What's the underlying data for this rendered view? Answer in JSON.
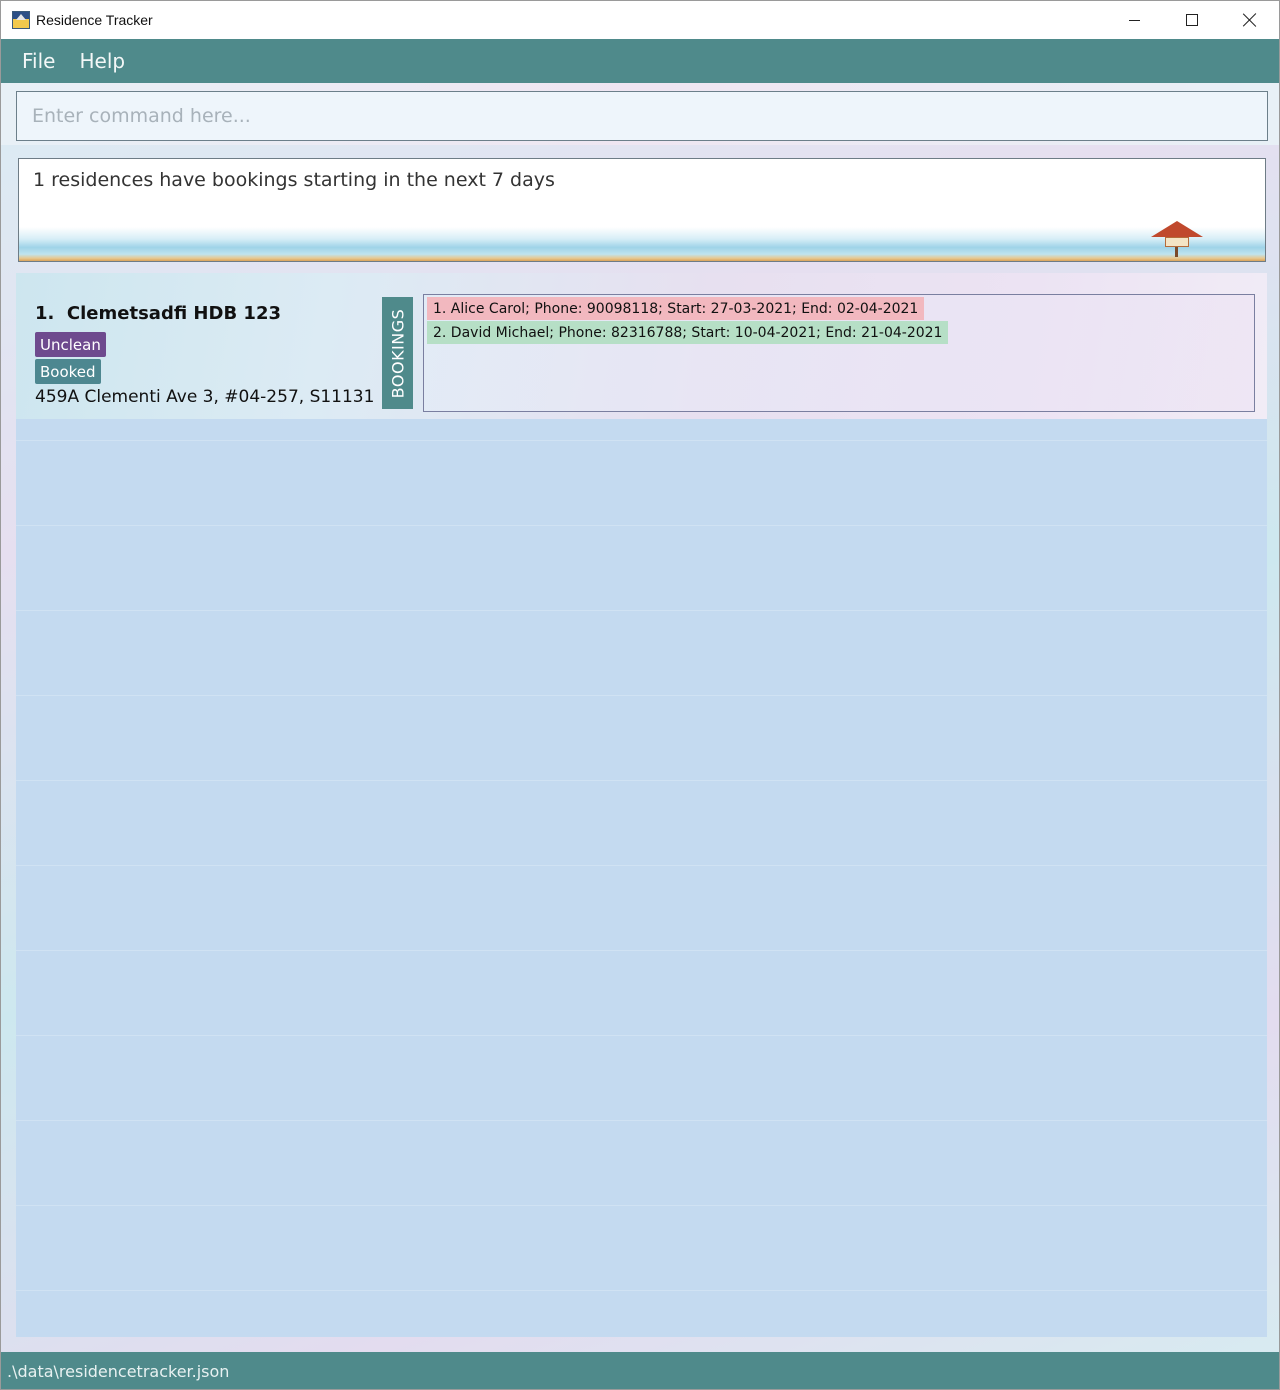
{
  "window": {
    "title": "Residence Tracker",
    "icon": "app-house-icon",
    "controls": [
      "minimize-icon",
      "maximize-icon",
      "close-icon"
    ]
  },
  "menu": {
    "items": [
      {
        "label": "File"
      },
      {
        "label": "Help"
      }
    ]
  },
  "command": {
    "placeholder": "Enter command here...",
    "value": ""
  },
  "result": {
    "message": "1 residences have bookings starting in the next 7 days"
  },
  "residences": [
    {
      "index": "1.",
      "name": "Clemetsadfi HDB 123",
      "tags": [
        {
          "label": "Unclean",
          "color": "#6e4a8e"
        },
        {
          "label": "Booked",
          "color": "#4d8790"
        }
      ],
      "address": "459A Clementi Ave 3, #04-257, S11131",
      "bookings_label": "BOOKINGS",
      "bookings": [
        {
          "text": "1. Alice Carol; Phone: 90098118; Start: 27-03-2021; End: 02-04-2021",
          "highlight": "#f2b8bf"
        },
        {
          "text": "2. David Michael; Phone: 82316788; Start: 10-04-2021; End: 21-04-2021",
          "highlight": "#b6dfc6"
        }
      ]
    }
  ],
  "status": {
    "file_path": ".\\data\\residencetracker.json"
  },
  "colors": {
    "accent": "#4f8a8b",
    "list_background": "#c4daf0"
  }
}
